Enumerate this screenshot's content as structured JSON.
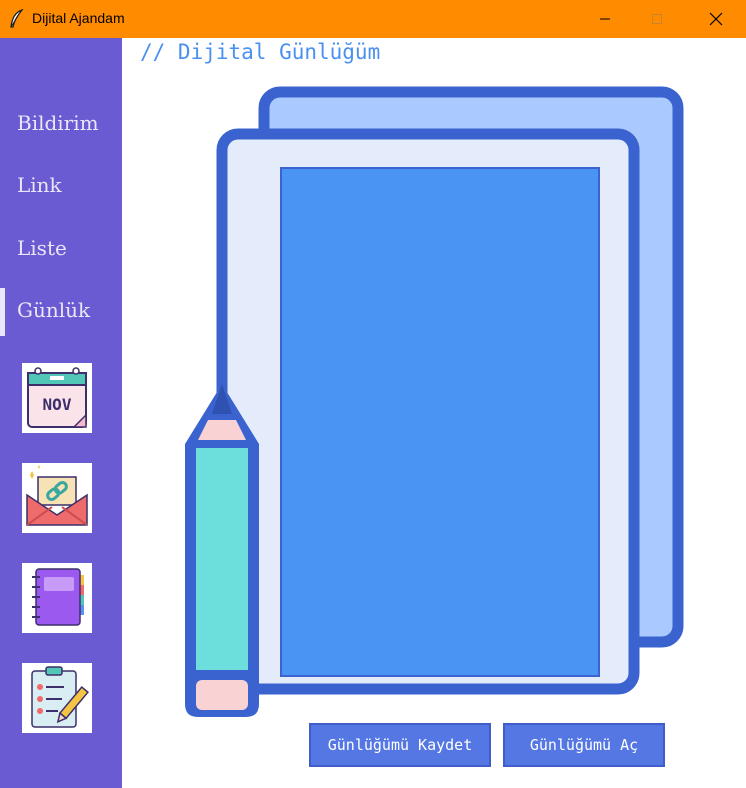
{
  "window": {
    "title": "Dijital Ajandam"
  },
  "sidebar": {
    "items": [
      {
        "label": "Bildirim"
      },
      {
        "label": "Link"
      },
      {
        "label": "Liste"
      },
      {
        "label": "Günlük"
      }
    ],
    "tiles": [
      {
        "icon": "calendar-icon",
        "text": "NOV"
      },
      {
        "icon": "mail-link-icon"
      },
      {
        "icon": "notebook-icon"
      },
      {
        "icon": "checklist-icon"
      }
    ]
  },
  "main": {
    "heading": "// Dijital Günlüğüm",
    "buttons": {
      "save": "Günlüğümü Kaydet",
      "open": "Günlüğümü Aç"
    }
  },
  "colors": {
    "titlebar": "#ff8c00",
    "sidebar": "#6b5bd2",
    "accent": "#4a90f0",
    "button": "#5577e3"
  }
}
